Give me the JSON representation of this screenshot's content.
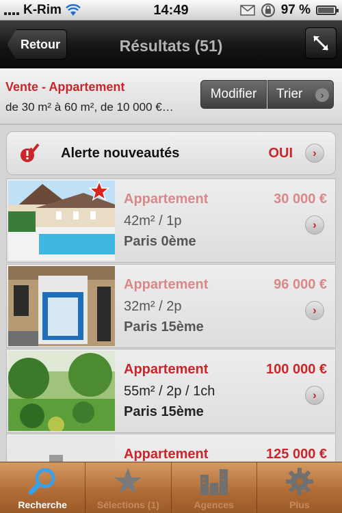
{
  "status_bar": {
    "carrier": "K-Rim",
    "time": "14:49",
    "battery": "97 %",
    "battery_level": 0.97
  },
  "nav": {
    "back_label": "Retour",
    "title": "Résultats (51)"
  },
  "criteria": {
    "title": "Vente - Appartement",
    "subtitle": "de 30 m² à 60 m², de 10 000 €…",
    "modify_label": "Modifier",
    "sort_label": "Trier"
  },
  "alert": {
    "label": "Alerte nouveautés",
    "value": "OUI"
  },
  "listings": [
    {
      "type": "Appartement",
      "price": "30 000 €",
      "size": "42m² / 1p",
      "city": "Paris 0ème",
      "photo": "pool-photo",
      "starred": true
    },
    {
      "type": "Appartement",
      "price": "96 000 €",
      "size": "32m² / 2p",
      "city": "Paris 15ème",
      "photo": "shopfront-photo"
    },
    {
      "type": "Appartement",
      "price": "100 000 €",
      "size": "55m² / 2p / 1ch",
      "city": "Paris 15ème",
      "photo": "garden-photo"
    },
    {
      "type": "Appartement",
      "price": "125 000 €",
      "size": "",
      "city": "",
      "photo": "building-photo"
    }
  ],
  "tabs": [
    {
      "label": "Recherche",
      "icon": "search-icon",
      "selected": true
    },
    {
      "label": "Sélections (1)",
      "icon": "star-icon"
    },
    {
      "label": "Agences",
      "icon": "buildings-icon"
    },
    {
      "label": "Plus",
      "icon": "gear-icon"
    }
  ],
  "colors": {
    "accent_red": "#c8262a",
    "tab_wood": "#b06a34",
    "tab_selected_blue": "#3aa0e8"
  }
}
